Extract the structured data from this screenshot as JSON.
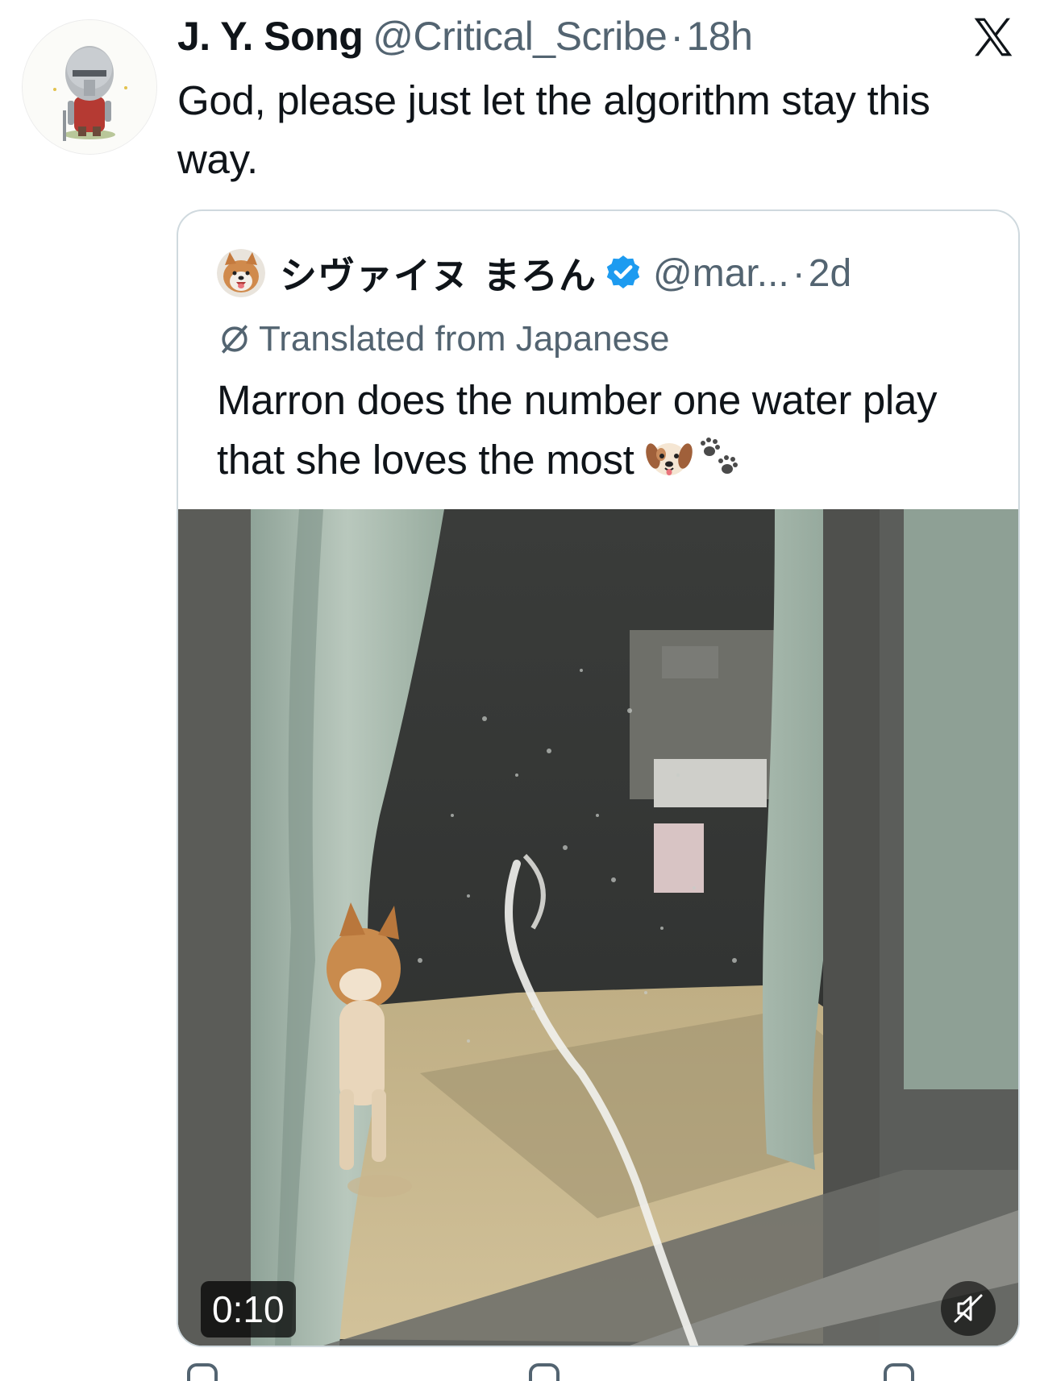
{
  "tweet": {
    "author_name": "J. Y. Song",
    "author_handle": "@Critical_Scribe",
    "separator": "·",
    "time": "18h",
    "text": "God, please just let the algorithm stay this way."
  },
  "quote": {
    "author_name": "シヴァイヌ まろん",
    "author_handle": "@mar...",
    "separator": "·",
    "time": "2d",
    "translated_label": "Translated from Japanese",
    "text": "Marron does the number one water play that she loves the most",
    "verified": true,
    "video": {
      "duration": "0:10",
      "muted": true
    }
  },
  "icons": {
    "brand": "x-logo-icon",
    "translate": "translate-icon",
    "verified": "verified-badge-icon",
    "dog_face": "dog-face-emoji",
    "paw_prints": "paw-prints-emoji",
    "mute": "speaker-muted-icon"
  },
  "colors": {
    "text_primary": "#0f1419",
    "text_secondary": "#536471",
    "verified_blue": "#1d9bf0",
    "card_border": "#cfd9de"
  }
}
